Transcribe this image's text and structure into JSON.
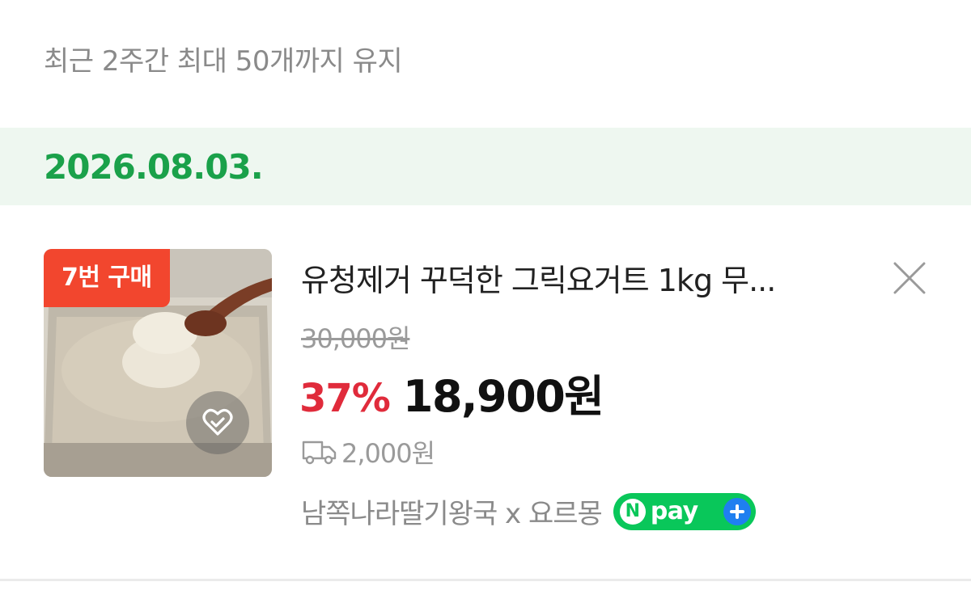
{
  "header": {
    "notice": "최근 2주간 최대 50개까지 유지"
  },
  "group": {
    "date": "2026.08.03."
  },
  "item": {
    "badge": "7번 구매",
    "title": "유청제거 꾸덕한 그릭요거트 1kg 무...",
    "original_price": "30,000원",
    "discount": "37%",
    "sale_price": "18,900원",
    "shipping": "2,000원",
    "seller": "남쪽나라딸기왕국 x 요르몽",
    "npay": {
      "n": "N",
      "label": "pay"
    }
  },
  "colors": {
    "date_green": "#1aa14a",
    "date_bar": "#eef7f0",
    "badge_red": "#f2462e",
    "discount_red": "#e02b3b",
    "npay_green": "#09c75a",
    "npay_plus_blue": "#1f7ff0"
  },
  "icons": {
    "wishlist": "heart-check-icon",
    "close": "close-icon",
    "shipping": "truck-icon",
    "npay_plus": "plus-icon"
  }
}
